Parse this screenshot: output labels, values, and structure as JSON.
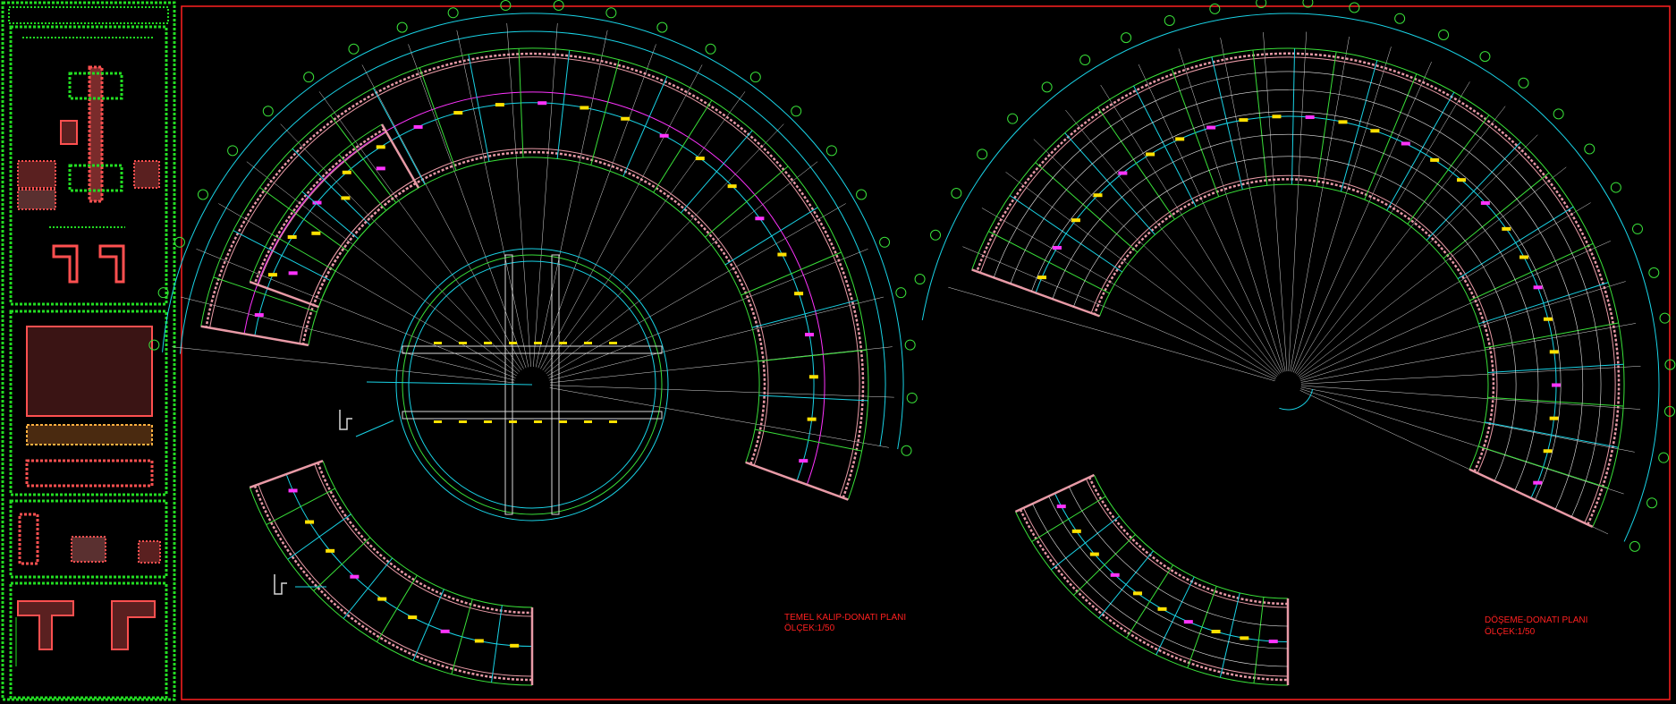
{
  "plans": [
    {
      "title": "TEMEL KALIP-DONATI PLANI",
      "scale": "ÖLÇEK:1/50"
    },
    {
      "title": "DÖŞEME-DONATI PLANI",
      "scale": "ÖLÇEK:1/50"
    }
  ],
  "colors": {
    "background": "#000000",
    "frame_red": "#ff2020",
    "grid_cyan": "#19d3e6",
    "beam_green": "#39e039",
    "slab_pink": "#e89aa6",
    "rebar_yellow": "#ffe000",
    "rebar_magenta": "#ff33ff",
    "axis_white": "#d8d8d8",
    "sidebar_green": "#22dd22"
  }
}
